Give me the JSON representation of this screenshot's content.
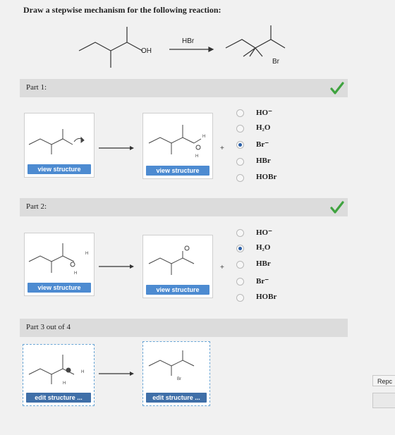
{
  "question": {
    "title": "Draw a stepwise mechanism for the following reaction:"
  },
  "reaction": {
    "reagent": "HBr",
    "reactant_group": "OH",
    "product_group": "Br"
  },
  "parts": [
    {
      "label": "Part 1:",
      "status": "correct",
      "buttons": [
        "view structure",
        "view structure"
      ],
      "plus": "+",
      "options": [
        {
          "label": "HO⁻",
          "selected": false
        },
        {
          "label": "H₂O",
          "selected": false
        },
        {
          "label": "Br⁻",
          "selected": true
        },
        {
          "label": "HBr",
          "selected": false
        },
        {
          "label": "HOBr",
          "selected": false
        }
      ]
    },
    {
      "label": "Part 2:",
      "status": "correct",
      "buttons": [
        "view structure",
        "view structure"
      ],
      "plus": "+",
      "options": [
        {
          "label": "HO⁻",
          "selected": false
        },
        {
          "label": "H₂O",
          "selected": true
        },
        {
          "label": "HBr",
          "selected": false
        },
        {
          "label": "Br⁻",
          "selected": false
        },
        {
          "label": "HOBr",
          "selected": false
        }
      ]
    },
    {
      "label": "Part 3 out of 4",
      "buttons": [
        "edit structure ...",
        "edit structure ..."
      ]
    }
  ],
  "side": {
    "report_label": "Repc"
  }
}
